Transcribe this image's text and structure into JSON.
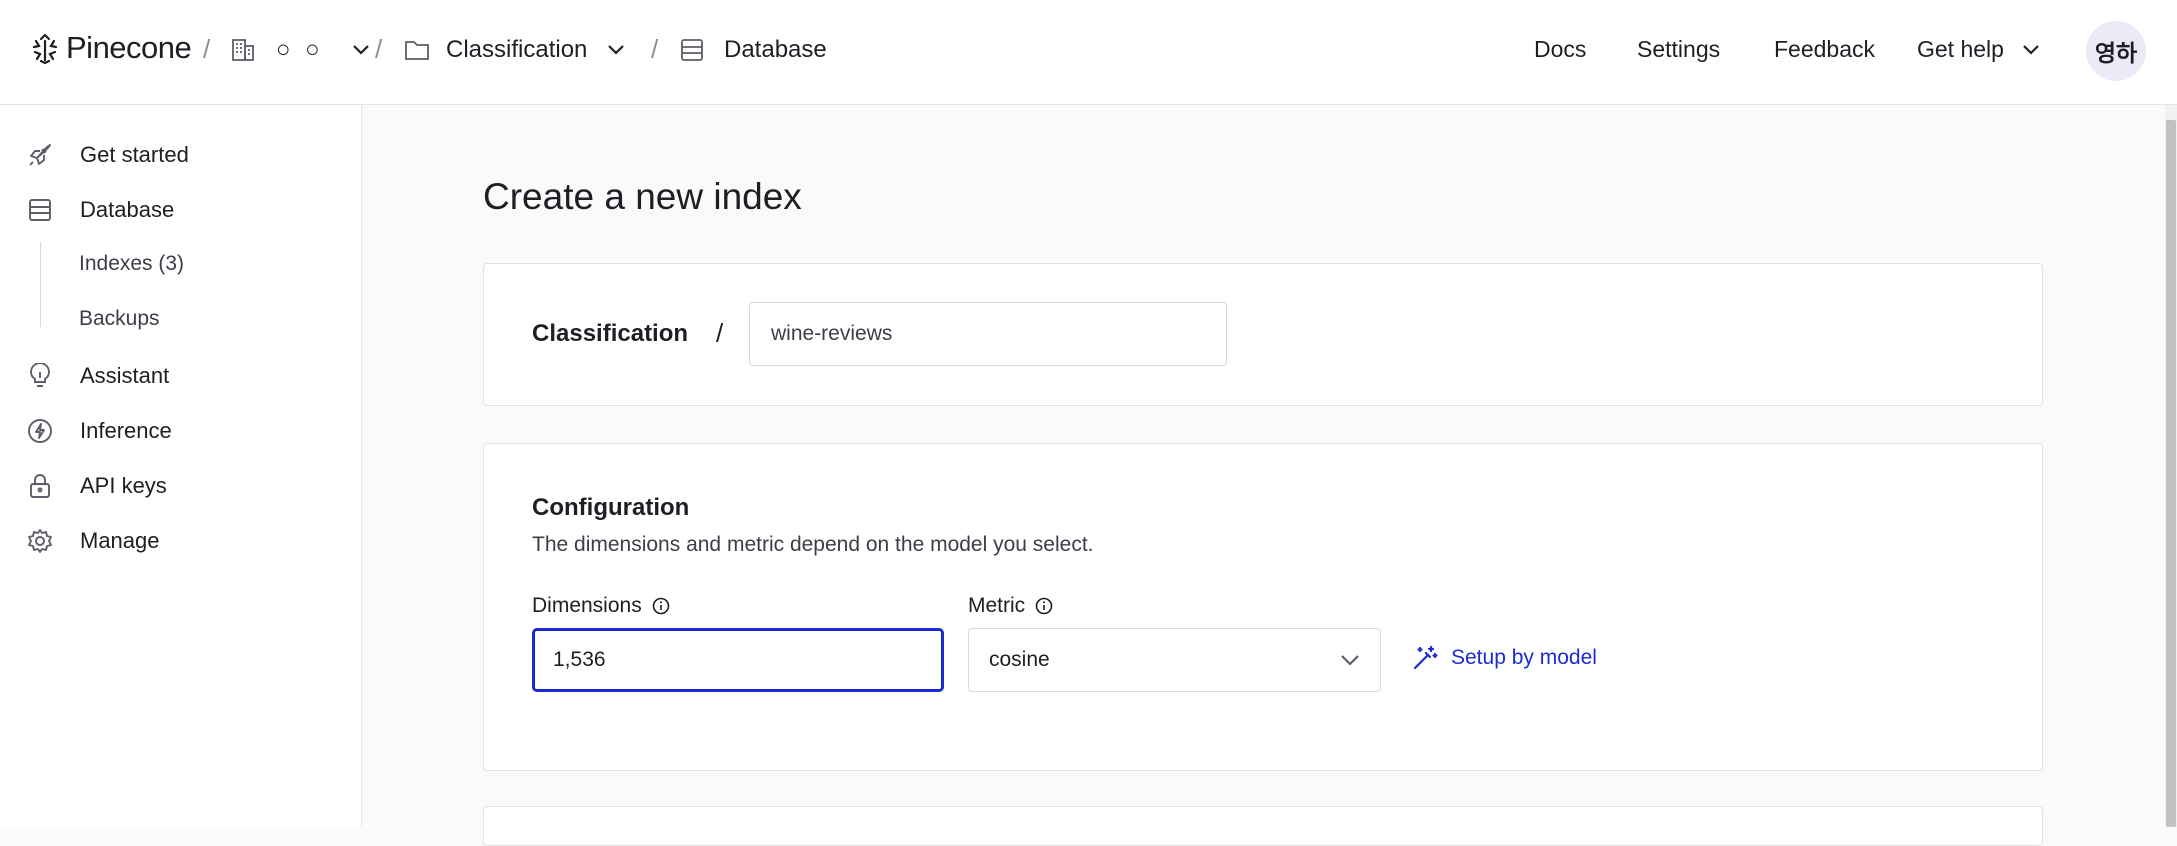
{
  "header": {
    "logo_text": "Pinecone",
    "org_name": "○ ○",
    "project_name": "Classification",
    "section_name": "Database",
    "nav": {
      "docs": "Docs",
      "settings": "Settings",
      "feedback": "Feedback",
      "get_help": "Get help"
    },
    "avatar_text": "영하"
  },
  "sidebar": {
    "items": [
      {
        "label": "Get started",
        "icon": "rocket-icon"
      },
      {
        "label": "Database",
        "icon": "database-icon"
      },
      {
        "label": "Assistant",
        "icon": "lightbulb-icon"
      },
      {
        "label": "Inference",
        "icon": "bolt-icon"
      },
      {
        "label": "API keys",
        "icon": "lock-icon"
      },
      {
        "label": "Manage",
        "icon": "gear-icon"
      }
    ],
    "subitems": [
      {
        "label": "Indexes (3)"
      },
      {
        "label": "Backups"
      }
    ]
  },
  "main": {
    "title": "Create a new index",
    "name_card": {
      "project_label": "Classification",
      "separator": "/",
      "index_name_value": "wine-reviews"
    },
    "config_card": {
      "title": "Configuration",
      "description": "The dimensions and metric depend on the model you select.",
      "dimensions_label": "Dimensions",
      "dimensions_value": "1,536",
      "metric_label": "Metric",
      "metric_value": "cosine",
      "setup_link": "Setup by model"
    }
  },
  "colors": {
    "accent": "#1b2bd1",
    "background": "#fafafa",
    "avatar_bg": "#ebebf7"
  }
}
